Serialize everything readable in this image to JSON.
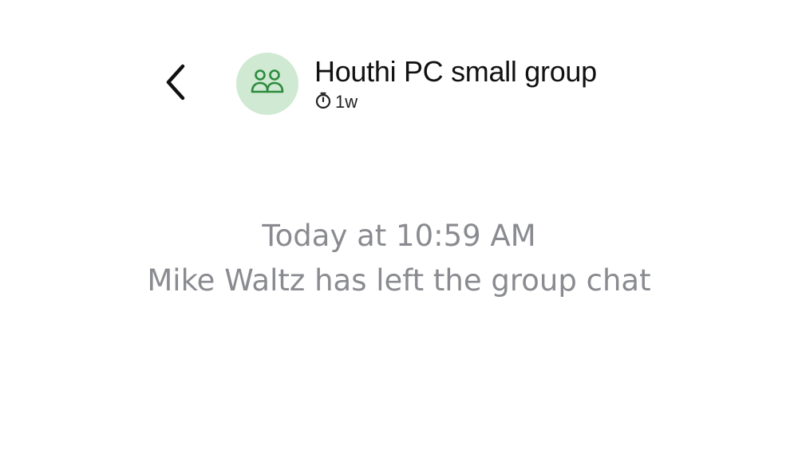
{
  "header": {
    "back_icon": "chevron-left-icon",
    "avatar_icon": "group-people-icon",
    "title": "Houthi PC small group",
    "disappearing_timer": {
      "icon": "timer-icon",
      "label": "1w"
    }
  },
  "conversation": {
    "system_message": {
      "timestamp": "Today at 10:59 AM",
      "text": "Mike Waltz has left the group chat"
    }
  },
  "colors": {
    "avatar_background": "#cfe9d2",
    "avatar_icon": "#2e8b3e",
    "system_text": "#8a8b90",
    "title_text": "#111111"
  }
}
